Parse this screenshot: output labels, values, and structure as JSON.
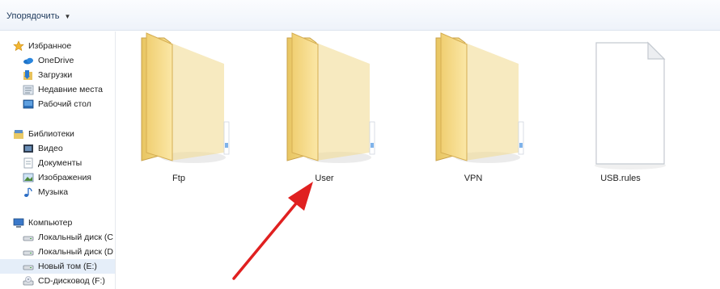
{
  "toolbar": {
    "organize_label": "Упорядочить"
  },
  "nav": {
    "favorites": {
      "label": "Избранное",
      "items": [
        {
          "label": "OneDrive",
          "icon": "onedrive-icon"
        },
        {
          "label": "Загрузки",
          "icon": "downloads-icon"
        },
        {
          "label": "Недавние места",
          "icon": "recent-places-icon"
        },
        {
          "label": "Рабочий стол",
          "icon": "desktop-icon"
        }
      ]
    },
    "libraries": {
      "label": "Библиотеки",
      "items": [
        {
          "label": "Видео",
          "icon": "video-icon"
        },
        {
          "label": "Документы",
          "icon": "documents-icon"
        },
        {
          "label": "Изображения",
          "icon": "pictures-icon"
        },
        {
          "label": "Музыка",
          "icon": "music-icon"
        }
      ]
    },
    "computer": {
      "label": "Компьютер",
      "items": [
        {
          "label": "Локальный диск (C",
          "icon": "drive-icon"
        },
        {
          "label": "Локальный диск (D",
          "icon": "drive-icon"
        },
        {
          "label": "Новый том (E:)",
          "icon": "drive-icon"
        },
        {
          "label": "CD-дисковод (F:)",
          "icon": "cd-drive-icon"
        }
      ]
    }
  },
  "files": [
    {
      "name": "Ftp",
      "type": "folder"
    },
    {
      "name": "User",
      "type": "folder"
    },
    {
      "name": "VPN",
      "type": "folder"
    },
    {
      "name": "USB.rules",
      "type": "file"
    }
  ],
  "colors": {
    "arrow": "#e02020",
    "folder": "#f5d77a",
    "selection": "#e5eef9"
  }
}
